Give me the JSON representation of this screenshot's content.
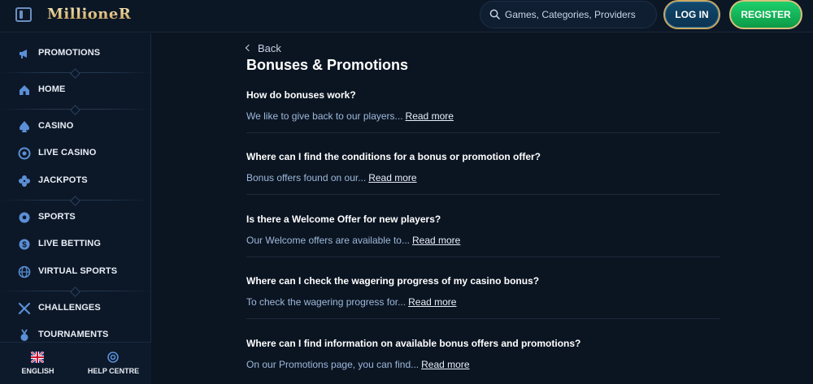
{
  "header": {
    "logo": "MillioneR",
    "search_placeholder": "Games, Categories, Providers",
    "login_label": "LOG IN",
    "register_label": "REGISTER"
  },
  "sidebar": {
    "items": [
      {
        "label": "PROMOTIONS",
        "icon": "megaphone-icon"
      },
      {
        "label": "HOME",
        "icon": "home-icon"
      },
      {
        "label": "CASINO",
        "icon": "spade-icon"
      },
      {
        "label": "LIVE CASINO",
        "icon": "chip-icon"
      },
      {
        "label": "JACKPOTS",
        "icon": "clover-icon"
      },
      {
        "label": "SPORTS",
        "icon": "soccer-ball-icon"
      },
      {
        "label": "LIVE BETTING",
        "icon": "dollar-coin-icon"
      },
      {
        "label": "VIRTUAL SPORTS",
        "icon": "globe-icon"
      },
      {
        "label": "CHALLENGES",
        "icon": "crossed-swords-icon"
      },
      {
        "label": "TOURNAMENTS",
        "icon": "medal-icon"
      }
    ],
    "footer": {
      "language_label": "ENGLISH",
      "help_label": "HELP CENTRE"
    }
  },
  "main": {
    "back_label": "Back",
    "title": "Bonuses & Promotions",
    "read_more_label": "Read more",
    "faqs": [
      {
        "question": "How do bonuses work?",
        "answer": "We like to give back to our players..."
      },
      {
        "question": "Where can I find the conditions for a bonus or promotion offer?",
        "answer": "Bonus offers found on our..."
      },
      {
        "question": "Is there a Welcome Offer for new players?",
        "answer": "Our Welcome offers are available to..."
      },
      {
        "question": "Where can I check the wagering progress of my casino bonus?",
        "answer": "To check the wagering progress for..."
      },
      {
        "question": "Where can I find information on available bonus offers and promotions?",
        "answer": "On our Promotions page, you can find..."
      }
    ]
  },
  "colors": {
    "background": "#0b1522",
    "accent_gold": "#c9a862",
    "register_green": "#1dcf6b",
    "login_blue": "#11486d",
    "answer_text": "#9fb8da"
  }
}
